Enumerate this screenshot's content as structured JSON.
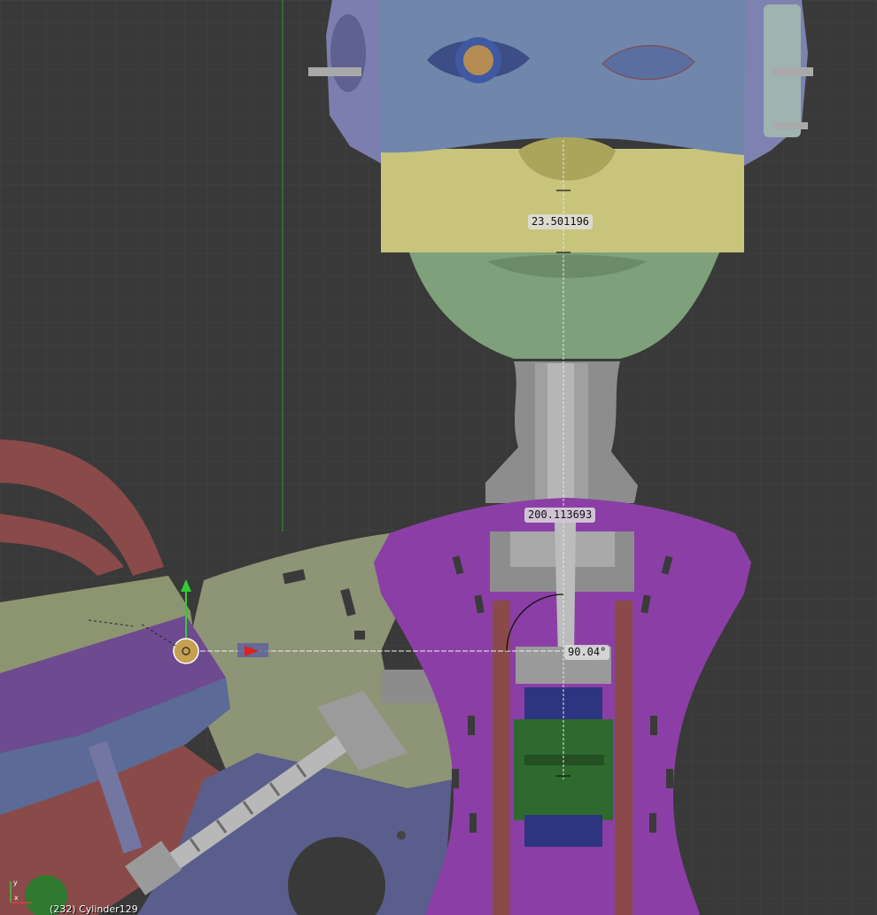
{
  "viewport": {
    "background": "#393939",
    "grid_minor_color": "#424242",
    "grid_major_color": "#4a4a4a",
    "y_axis_line_color": "#2d8a2d"
  },
  "measurements": {
    "distance_a": "23.501196",
    "distance_b": "200.113693",
    "angle": "90.04°"
  },
  "object_info": "(232) Cylinder129",
  "axis_gizmo": {
    "x_label": "x",
    "y_label": "y",
    "x_color": "#e04040",
    "y_color": "#40c040"
  },
  "materials": {
    "face_upper": "#7185a8",
    "face_band": "#c8c47c",
    "face_lower": "#7ea07a",
    "neck": "#8c8c8c",
    "torso_plate": "#8b3fa6",
    "frame_red": "#8a4a4a",
    "arm_plate": "#8e9476",
    "arm_gear_purple": "#6e4a90",
    "blue_part": "#5a5e8c",
    "dark_blue_servo": "#2e3580",
    "green_servo": "#2e6a2e",
    "steel": "#a8a8a8"
  },
  "icons": {
    "cursor": "3d-cursor-icon",
    "manipulator": "transform-manipulator-icon"
  }
}
